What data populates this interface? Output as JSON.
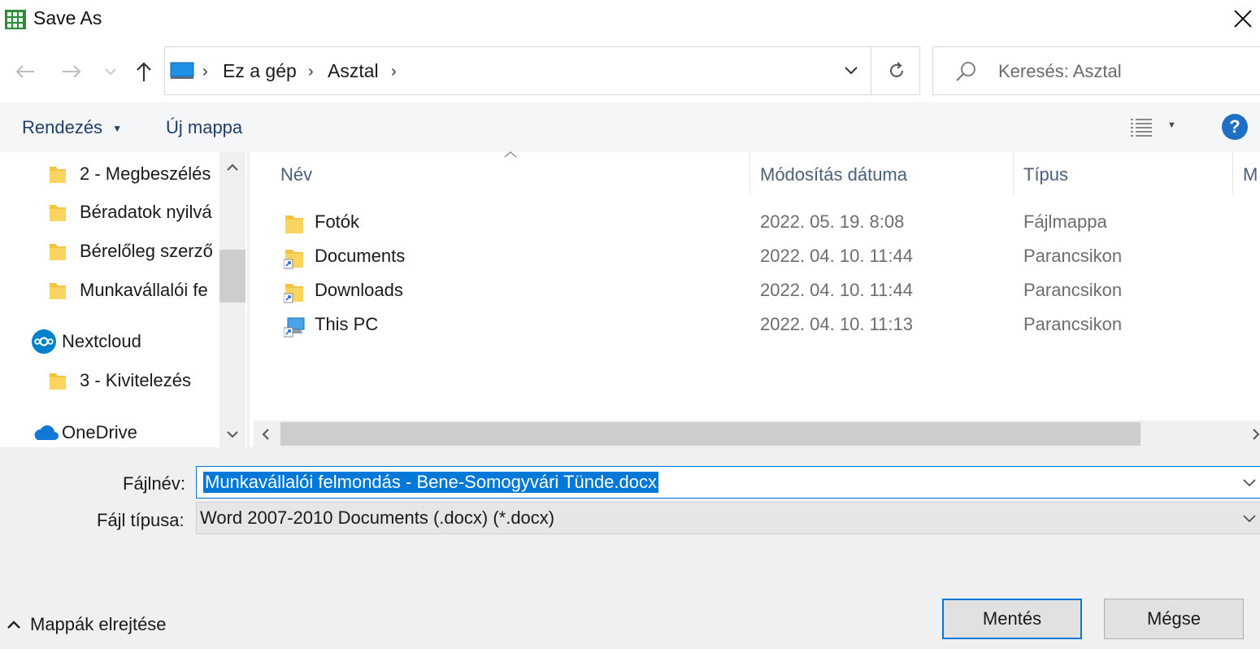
{
  "window": {
    "title": "Save As"
  },
  "address": {
    "crumbs": [
      "Ez a gép",
      "Asztal"
    ]
  },
  "search": {
    "placeholder": "Keresés: Asztal"
  },
  "toolbar": {
    "organize_label": "Rendezés",
    "new_folder_label": "Új mappa"
  },
  "nav_pane": {
    "items": [
      {
        "label": "2 - Megbeszélés",
        "icon": "folder-icon"
      },
      {
        "label": "Béradatok nyilvá",
        "icon": "folder-icon"
      },
      {
        "label": "Bérelőleg szerző",
        "icon": "folder-icon"
      },
      {
        "label": "Munkavállalói fe",
        "icon": "folder-icon"
      },
      {
        "label": "Nextcloud",
        "icon": "nextcloud-icon"
      },
      {
        "label": "3 - Kivitelezés",
        "icon": "folder-icon"
      },
      {
        "label": "OneDrive",
        "icon": "onedrive-icon"
      }
    ]
  },
  "file_list": {
    "columns": [
      "Név",
      "Módosítás dátuma",
      "Típus",
      "M"
    ],
    "rows": [
      {
        "name": "Fotók",
        "date": "2022. 05. 19. 8:08",
        "type": "Fájlmappa",
        "icon": "folder-icon"
      },
      {
        "name": "Documents",
        "date": "2022. 04. 10. 11:44",
        "type": "Parancsikon",
        "icon": "folder-shortcut-icon"
      },
      {
        "name": "Downloads",
        "date": "2022. 04. 10. 11:44",
        "type": "Parancsikon",
        "icon": "folder-shortcut-icon"
      },
      {
        "name": "This PC",
        "date": "2022. 04. 10. 11:13",
        "type": "Parancsikon",
        "icon": "pc-shortcut-icon"
      }
    ]
  },
  "form": {
    "filename_label": "Fájlnév:",
    "filename_value": "Munkavállalói felmondás - Bene-Somogyvári Tünde.docx",
    "filetype_label": "Fájl típusa:",
    "filetype_value": "Word 2007-2010 Documents (.docx) (*.docx)"
  },
  "footer": {
    "hide_folders_label": "Mappák elrejtése",
    "save_label": "Mentés",
    "cancel_label": "Mégse"
  },
  "colors": {
    "accent": "#0078d7",
    "help": "#1f6fc5",
    "folder": "#f5c342",
    "link_text": "#1f3f6b"
  }
}
